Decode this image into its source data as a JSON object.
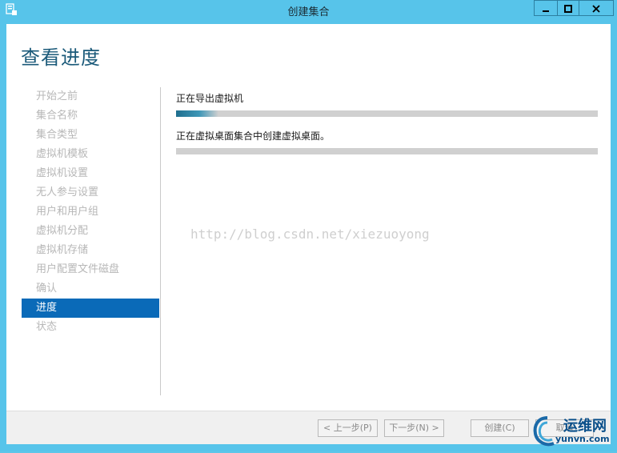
{
  "window": {
    "title": "创建集合",
    "controls": {
      "minimize": "minimize-icon",
      "maximize": "maximize-icon",
      "close": "close-icon"
    }
  },
  "page": {
    "title": "查看进度"
  },
  "nav": {
    "items": [
      {
        "label": "开始之前",
        "active": false
      },
      {
        "label": "集合名称",
        "active": false
      },
      {
        "label": "集合类型",
        "active": false
      },
      {
        "label": "虚拟机模板",
        "active": false
      },
      {
        "label": "虚拟机设置",
        "active": false
      },
      {
        "label": "无人参与设置",
        "active": false
      },
      {
        "label": "用户和用户组",
        "active": false
      },
      {
        "label": "虚拟机分配",
        "active": false
      },
      {
        "label": "虚拟机存储",
        "active": false
      },
      {
        "label": "用户配置文件磁盘",
        "active": false
      },
      {
        "label": "确认",
        "active": false
      },
      {
        "label": "进度",
        "active": true
      },
      {
        "label": "状态",
        "active": false
      }
    ]
  },
  "tasks": [
    {
      "label": "正在导出虚拟机",
      "progress": 0.1
    },
    {
      "label": "正在虚拟桌面集合中创建虚拟桌面。",
      "progress": 0
    }
  ],
  "watermark": "http://blog.csdn.net/xiezuoyong",
  "footer": {
    "prev": "< 上一步(P)",
    "next": "下一步(N) >",
    "create": "创建(C)",
    "cancel": "取消"
  },
  "logo": {
    "name": "运维网",
    "domain": "yunvn.com"
  },
  "colors": {
    "titlebar": "#57c4ea",
    "accent": "#0a6ab8",
    "progress": "#1f6f8f"
  }
}
